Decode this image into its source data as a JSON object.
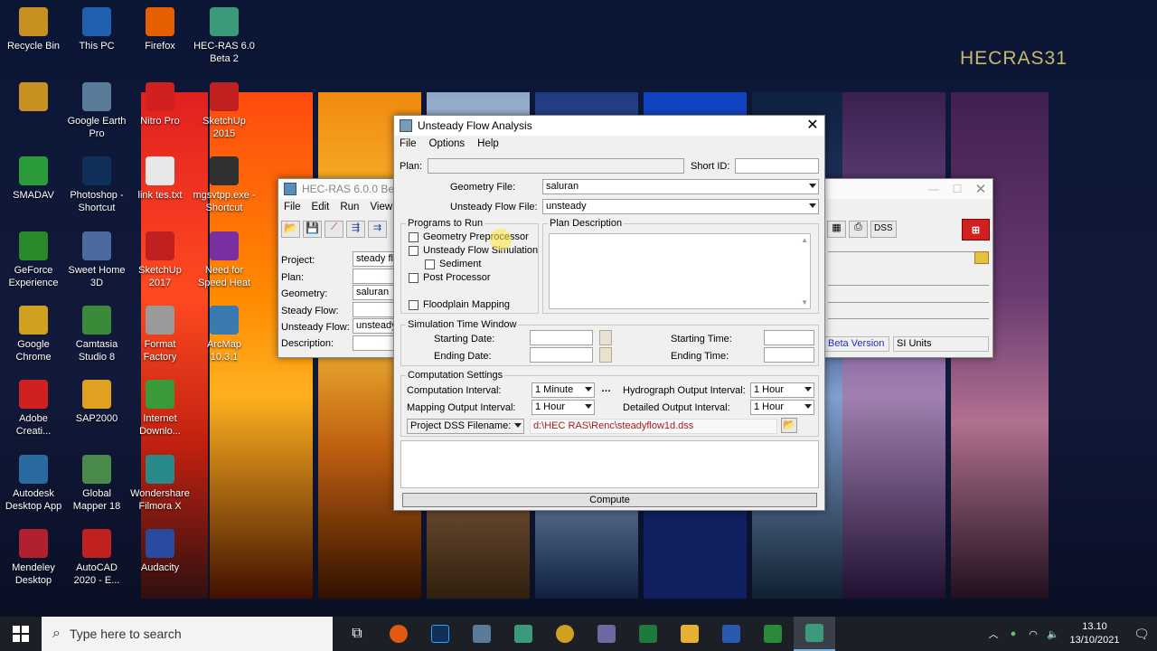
{
  "desktop": {
    "watermark": "HECRAS31",
    "icons": [
      {
        "label": "Recycle Bin",
        "icon": "recycle-bin-icon",
        "color": "#c89020"
      },
      {
        "label": "This PC",
        "icon": "this-pc-icon",
        "color": "#2060b0"
      },
      {
        "label": "Firefox",
        "icon": "firefox-icon",
        "color": "#e66000"
      },
      {
        "label": "HEC-RAS 6.0 Beta 2",
        "icon": "hecras-icon",
        "color": "#3a9a7a"
      },
      {
        "label": "",
        "icon": "user-avatar-icon",
        "color": "#c89020"
      },
      {
        "label": "Google Earth Pro",
        "icon": "google-earth-icon",
        "color": "#5a7a9a"
      },
      {
        "label": "Nitro Pro",
        "icon": "nitro-icon",
        "color": "#d02020"
      },
      {
        "label": "SketchUp 2015",
        "icon": "sketchup-icon",
        "color": "#c02020"
      },
      {
        "label": "SMADAV",
        "icon": "smadav-icon",
        "color": "#2a9a3a"
      },
      {
        "label": "Photoshop - Shortcut",
        "icon": "photoshop-icon",
        "color": "#10305a"
      },
      {
        "label": "link tes.txt",
        "icon": "text-file-icon",
        "color": "#e8e8e8"
      },
      {
        "label": "mgsvtpp.exe - Shortcut",
        "icon": "exe-icon",
        "color": "#303030"
      },
      {
        "label": "GeForce Experience",
        "icon": "geforce-icon",
        "color": "#2a8a2a"
      },
      {
        "label": "Sweet Home 3D",
        "icon": "sweet-home-icon",
        "color": "#4a6aa0"
      },
      {
        "label": "SketchUp 2017",
        "icon": "sketchup-icon",
        "color": "#c02020"
      },
      {
        "label": "Need for Speed Heat",
        "icon": "nfs-icon",
        "color": "#7a30a0"
      },
      {
        "label": "Google Chrome",
        "icon": "chrome-icon",
        "color": "#d0a020"
      },
      {
        "label": "Camtasia Studio 8",
        "icon": "camtasia-icon",
        "color": "#3a8a3a"
      },
      {
        "label": "Format Factory",
        "icon": "format-factory-icon",
        "color": "#9a9a9a"
      },
      {
        "label": "ArcMap 10.3.1",
        "icon": "arcmap-icon",
        "color": "#3a7ab0"
      },
      {
        "label": "Adobe Creati...",
        "icon": "adobe-cc-icon",
        "color": "#d02020"
      },
      {
        "label": "SAP2000",
        "icon": "sap2000-icon",
        "color": "#e0a020"
      },
      {
        "label": "Internet Downlo...",
        "icon": "idm-icon",
        "color": "#3a9a3a"
      },
      {
        "label": "Autodesk Desktop App",
        "icon": "autodesk-icon",
        "color": "#2a6aa0"
      },
      {
        "label": "Global Mapper 18",
        "icon": "global-mapper-icon",
        "color": "#4a8a4a"
      },
      {
        "label": "Wondershare Filmora X",
        "icon": "filmora-icon",
        "color": "#2a8a8a"
      },
      {
        "label": "Mendeley Desktop",
        "icon": "mendeley-icon",
        "color": "#b02030"
      },
      {
        "label": "AutoCAD 2020 - E...",
        "icon": "autocad-icon",
        "color": "#c02020"
      },
      {
        "label": "Audacity",
        "icon": "audacity-icon",
        "color": "#2a4aa0"
      }
    ]
  },
  "hecras_main": {
    "title": "HEC-RAS 6.0.0 Beta 2",
    "menu": [
      "File",
      "Edit",
      "Run",
      "View"
    ],
    "labels": {
      "project": "Project:",
      "plan": "Plan:",
      "geometry": "Geometry:",
      "steady": "Steady Flow:",
      "unsteady": "Unsteady Flow:",
      "description": "Description:"
    },
    "values": {
      "project": "steady flo",
      "plan": "",
      "geometry": "saluran",
      "steady": "",
      "unsteady": "unsteady",
      "description": ""
    },
    "dss": "DSS",
    "beta_version": "Beta Version",
    "units": "SI Units"
  },
  "dialog": {
    "title": "Unsteady Flow Analysis",
    "menu": [
      "File",
      "Options",
      "Help"
    ],
    "plan_label": "Plan:",
    "plan_value": "",
    "short_id_label": "Short ID:",
    "short_id_value": "",
    "geometry_file_label": "Geometry File:",
    "geometry_file_value": "saluran",
    "unsteady_file_label": "Unsteady Flow File:",
    "unsteady_file_value": "unsteady",
    "programs_title": "Programs to Run",
    "programs": {
      "geometry_preprocessor": "Geometry Preprocessor",
      "unsteady_simulation": "Unsteady Flow Simulation",
      "sediment": "Sediment",
      "post_processor": "Post Processor",
      "floodplain": "Floodplain Mapping"
    },
    "plan_description_title": "Plan Description",
    "sim_window_title": "Simulation Time Window",
    "starting_date_label": "Starting Date:",
    "ending_date_label": "Ending Date:",
    "starting_time_label": "Starting Time:",
    "ending_time_label": "Ending Time:",
    "computation_title": "Computation Settings",
    "computation_interval_label": "Computation Interval:",
    "computation_interval_value": "1 Minute",
    "hydrograph_label": "Hydrograph Output Interval:",
    "hydrograph_value": "1 Hour",
    "mapping_label": "Mapping Output Interval:",
    "mapping_value": "1 Hour",
    "detailed_label": "Detailed Output Interval:",
    "detailed_value": "1 Hour",
    "dss_filename_label": "Project DSS Filename:",
    "dss_filename_value": "d:\\HEC RAS\\Renc\\steadyflow1d.dss",
    "compute_label": "Compute"
  },
  "taskbar": {
    "search_placeholder": "Type here to search",
    "time": "13.10",
    "date": "13/10/2021"
  }
}
